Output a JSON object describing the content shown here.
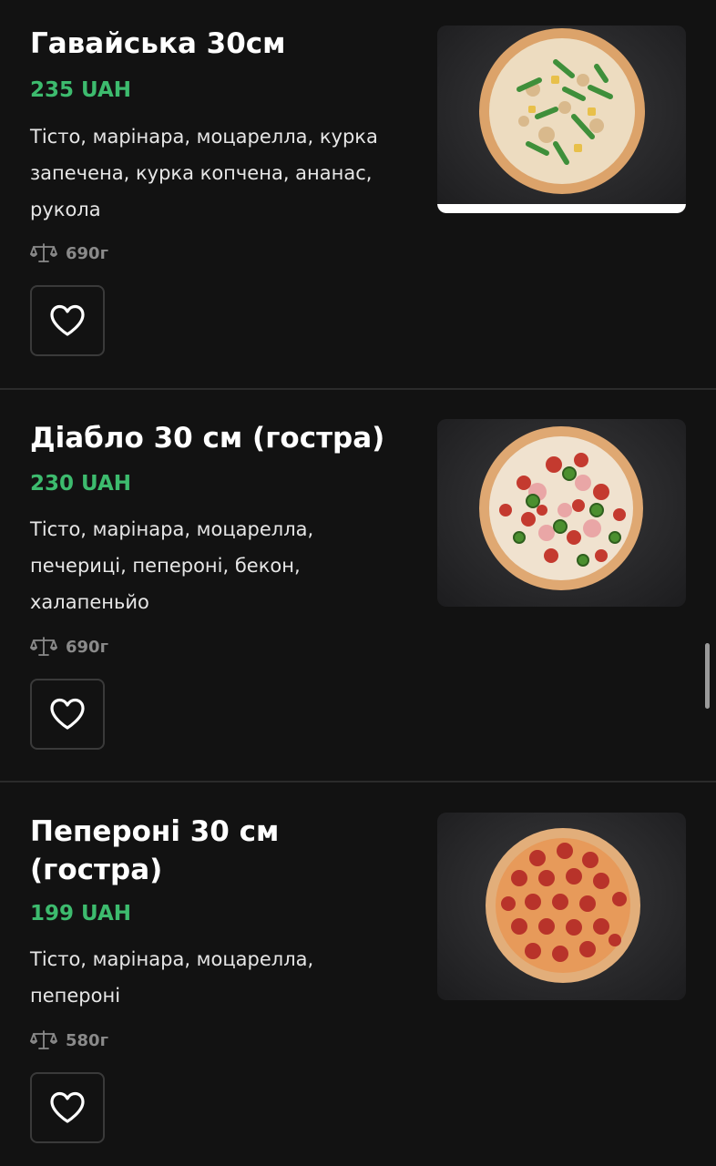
{
  "items": [
    {
      "title": "Гавайська 30см",
      "price": "235 UAH",
      "description": "Тісто, марінара, моцарелла, курка запечена, курка копчена, ананас, рукола",
      "weight": "690г",
      "image_icon": "pizza-hawaiian-image"
    },
    {
      "title": "Діабло 30 см (гостра)",
      "price": "230 UAH",
      "description": "Тісто, марінара, моцарелла, печериці, пепероні, бекон, халапеньйо",
      "weight": "690г",
      "image_icon": "pizza-diablo-image"
    },
    {
      "title": "Пепероні 30 см (гостра)",
      "price": "199 UAH",
      "description": "Тісто, марінара, моцарелла, пепероні",
      "weight": "580г",
      "image_icon": "pizza-pepperoni-image"
    }
  ],
  "colors": {
    "background": "#121212",
    "price": "#3dbb6e",
    "title": "#ffffff",
    "description": "#e6e6e6",
    "weight": "#8a8a8a",
    "divider": "#2b2b2b"
  },
  "icons": {
    "weight": "scale-icon",
    "favorite": "heart-icon"
  }
}
